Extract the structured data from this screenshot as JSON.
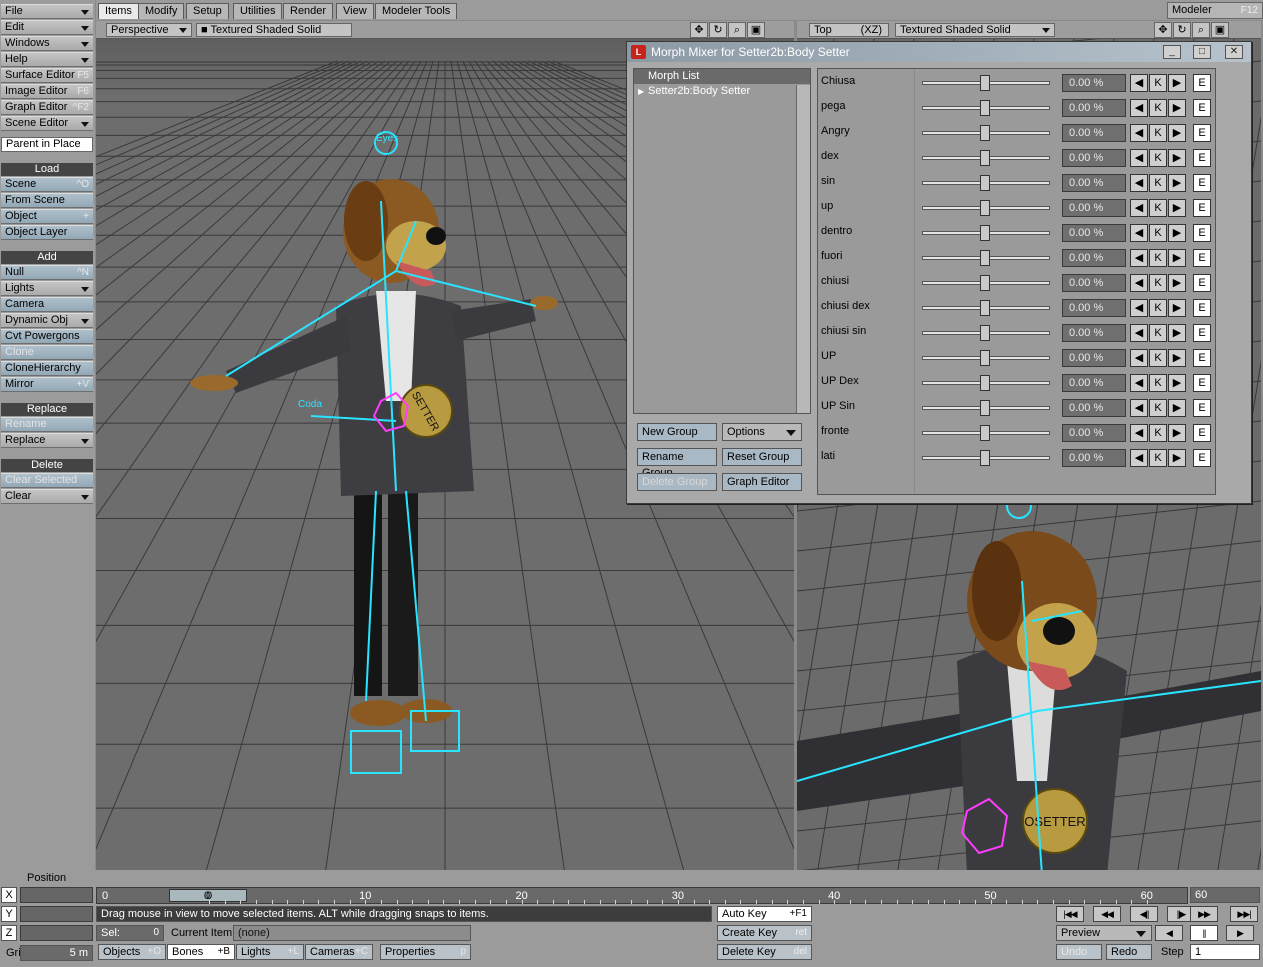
{
  "tabs": [
    "Items",
    "Modify",
    "Setup",
    "Utilities",
    "Render",
    "View",
    "Modeler Tools"
  ],
  "active_tab": "Items",
  "modeler": {
    "label": "Modeler",
    "shortcut": "F12"
  },
  "left_panel": {
    "menus": [
      {
        "label": "File",
        "type": "dropdown"
      },
      {
        "label": "Edit",
        "type": "dropdown"
      },
      {
        "label": "Windows",
        "type": "dropdown"
      },
      {
        "label": "Help",
        "type": "dropdown"
      },
      {
        "label": "Surface Editor",
        "shortcut": "F5"
      },
      {
        "label": "Image Editor",
        "shortcut": "F6"
      },
      {
        "label": "Graph Editor",
        "shortcut": "^F2"
      },
      {
        "label": "Scene Editor",
        "type": "dropdown"
      }
    ],
    "parent_in_place": "Parent in Place",
    "load_header": "Load",
    "load_items": [
      {
        "label": "Scene",
        "shortcut": "^O"
      },
      {
        "label": "From Scene",
        "shortcut": ""
      },
      {
        "label": "Object",
        "shortcut": "+"
      },
      {
        "label": "Object Layer",
        "shortcut": ""
      }
    ],
    "add_header": "Add",
    "add_items": [
      {
        "label": "Null",
        "shortcut": "^N"
      },
      {
        "label": "Lights",
        "type": "dropdown"
      },
      {
        "label": "Camera",
        "shortcut": ""
      },
      {
        "label": "Dynamic Obj",
        "type": "dropdown"
      },
      {
        "label": "Cvt Powergons",
        "shortcut": ""
      },
      {
        "label": "Clone",
        "disabled": true
      },
      {
        "label": "CloneHierarchy",
        "shortcut": ""
      },
      {
        "label": "Mirror",
        "shortcut": "+V"
      }
    ],
    "replace_header": "Replace",
    "replace_items": [
      {
        "label": "Rename",
        "disabled": true
      },
      {
        "label": "Replace",
        "type": "dropdown"
      }
    ],
    "delete_header": "Delete",
    "delete_items": [
      {
        "label": "Clear Selected",
        "disabled": true
      },
      {
        "label": "Clear",
        "type": "dropdown"
      }
    ]
  },
  "viewport_left": {
    "view": "Perspective",
    "render_mode": "Textured Shaded Solid"
  },
  "viewport_right": {
    "view": "Top",
    "axes": "(XZ)",
    "render_mode": "Textured Shaded Solid"
  },
  "scene_labels": {
    "eyes": "Eyes",
    "coda": "Coda",
    "medal": "SETTER",
    "medal_right": "OSETTER"
  },
  "morph_mixer": {
    "title": "Morph Mixer for Setter2b:Body Setter",
    "list_header": "Morph List",
    "list_item": "Setter2b:Body Setter",
    "buttons": {
      "new_group": "New Group",
      "options": "Options",
      "rename_group": "Rename Group",
      "reset_group": "Reset Group",
      "delete_group": "Delete Group",
      "graph_editor": "Graph Editor"
    },
    "key_label": "K",
    "envelope_label": "E",
    "morphs": [
      {
        "name": "Chiusa",
        "value": "0.00 %",
        "level": 0
      },
      {
        "name": "pega",
        "value": "0.00 %",
        "level": 0
      },
      {
        "name": "Angry",
        "value": "0.00 %",
        "level": 0
      },
      {
        "name": "dex",
        "value": "0.00 %",
        "level": 0
      },
      {
        "name": "sin",
        "value": "0.00 %",
        "level": 0
      },
      {
        "name": "up",
        "value": "0.00 %",
        "level": 0
      },
      {
        "name": "dentro",
        "value": "0.00 %",
        "level": 0
      },
      {
        "name": "fuori",
        "value": "0.00 %",
        "level": 0
      },
      {
        "name": "chiusi",
        "value": "0.00 %",
        "level": 0
      },
      {
        "name": "chiusi dex",
        "value": "0.00 %",
        "level": 0
      },
      {
        "name": "chiusi sin",
        "value": "0.00 %",
        "level": 0
      },
      {
        "name": "UP",
        "value": "0.00 %",
        "level": 0
      },
      {
        "name": "UP Dex",
        "value": "0.00 %",
        "level": 0
      },
      {
        "name": "UP Sin",
        "value": "0.00 %",
        "level": 0
      },
      {
        "name": "fronte",
        "value": "0.00 %",
        "level": 0
      },
      {
        "name": "lati",
        "value": "0.00 %",
        "level": 0
      }
    ]
  },
  "bottom": {
    "position_label": "Position",
    "axes": [
      "X",
      "Y",
      "Z"
    ],
    "grid_label": "Grid:",
    "grid_value": "5 m",
    "timeline_start": "0",
    "timeline_end": "60",
    "timeline_ticks": [
      "0",
      "10",
      "20",
      "30",
      "40",
      "50",
      "60"
    ],
    "current_frame": "0",
    "status": "Drag mouse in view to move selected items. ALT while dragging snaps to items.",
    "sel_label": "Sel:",
    "sel_value": "0",
    "current_item_label": "Current Item",
    "current_item_value": "(none)",
    "mode_tabs": [
      {
        "label": "Objects",
        "shortcut": "+O"
      },
      {
        "label": "Bones",
        "shortcut": "+B"
      },
      {
        "label": "Lights",
        "shortcut": "+L"
      },
      {
        "label": "Cameras",
        "shortcut": "+C"
      }
    ],
    "properties": {
      "label": "Properties",
      "shortcut": "p"
    },
    "auto_key": {
      "label": "Auto Key",
      "shortcut": "+F1"
    },
    "create_key": {
      "label": "Create Key",
      "shortcut": "ret"
    },
    "delete_key": {
      "label": "Delete Key",
      "shortcut": "del"
    },
    "preview": "Preview",
    "undo": "Undo",
    "redo": "Redo",
    "step_label": "Step",
    "step_value": "1"
  }
}
